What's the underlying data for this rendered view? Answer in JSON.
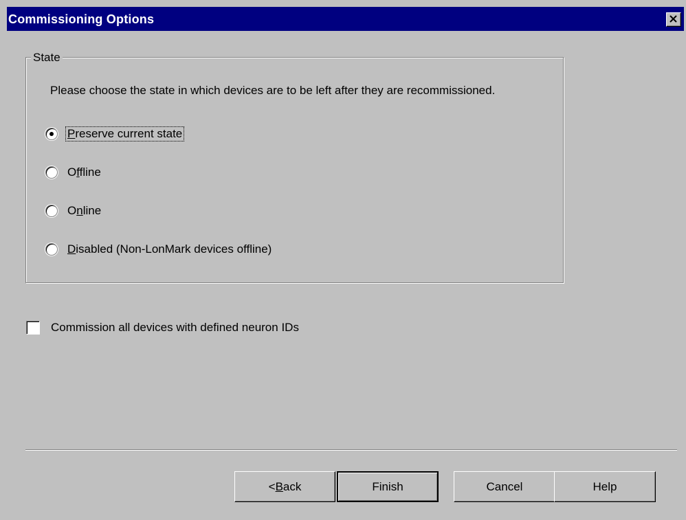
{
  "window": {
    "title": "Commissioning Options"
  },
  "state_group": {
    "legend": "State",
    "description": "Please choose the state in which devices are to be left after they are recommissioned.",
    "options": [
      {
        "label": "Preserve current state",
        "selected": true,
        "focused": true
      },
      {
        "label": "Offline",
        "selected": false
      },
      {
        "label": "Online",
        "selected": false
      },
      {
        "label": "Disabled (Non-LonMark devices offline)",
        "selected": false
      }
    ]
  },
  "commission_all": {
    "label": "Commission all devices with defined neuron IDs",
    "checked": false
  },
  "buttons": {
    "back": "< Back",
    "finish": "Finish",
    "cancel": "Cancel",
    "help": "Help"
  },
  "colors": {
    "titlebar": "#000080",
    "face": "#c0c0c0"
  },
  "icons": {
    "close": "close-icon"
  }
}
